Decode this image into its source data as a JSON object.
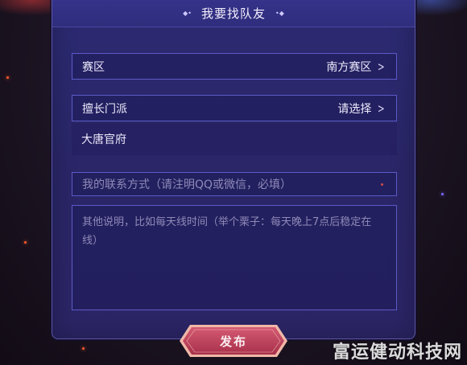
{
  "header": {
    "title": "我要找队友"
  },
  "form": {
    "region": {
      "label": "赛区",
      "value": "南方赛区"
    },
    "sect": {
      "label": "擅长门派",
      "value": "请选择"
    },
    "selected_sect": "大唐官府",
    "contact": {
      "placeholder": "我的联系方式（请注明QQ或微信，必填）"
    },
    "notes": {
      "placeholder": "其他说明，比如每天线时间（举个栗子：每天晚上7点后稳定在线）"
    }
  },
  "actions": {
    "publish_label": "发布"
  },
  "watermark": "富运健动科技网",
  "colors": {
    "panel": "#2c2a72",
    "border": "#5c5ac8",
    "button": "#c0405a"
  }
}
